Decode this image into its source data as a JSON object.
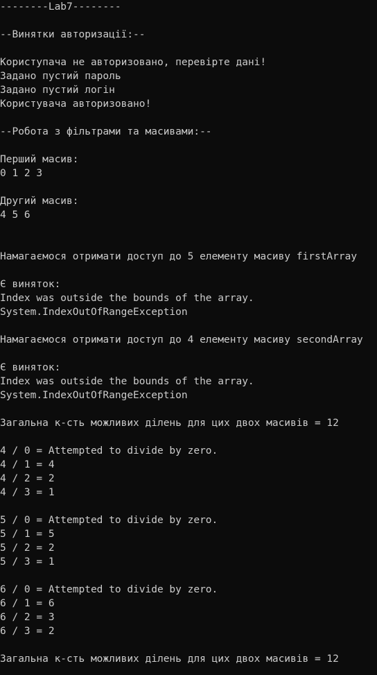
{
  "console": {
    "lines": [
      "--------Lab7--------",
      "",
      "--Винятки авторизації:--",
      "",
      "Користупача не авторизовано, перевірте дані!",
      "Задано пустий пароль",
      "Задано пустий логін",
      "Користувача авторизовано!",
      "",
      "--Робота з фільтрами та масивами:--",
      "",
      "Перший масив:",
      "0 1 2 3",
      "",
      "Другий масив:",
      "4 5 6",
      "",
      "",
      "Намагаємося отримати доступ до 5 елементу масиву firstArray",
      "",
      "Є виняток:",
      "Index was outside the bounds of the array.",
      "System.IndexOutOfRangeException",
      "",
      "Намагаємося отримати доступ до 4 елементу масиву secondArray",
      "",
      "Є виняток:",
      "Index was outside the bounds of the array.",
      "System.IndexOutOfRangeException",
      "",
      "Загальна к-сть можливих ділень для цих двох масивів = 12",
      "",
      "4 / 0 = Attempted to divide by zero.",
      "4 / 1 = 4",
      "4 / 2 = 2",
      "4 / 3 = 1",
      "",
      "5 / 0 = Attempted to divide by zero.",
      "5 / 1 = 5",
      "5 / 2 = 2",
      "5 / 3 = 1",
      "",
      "6 / 0 = Attempted to divide by zero.",
      "6 / 1 = 6",
      "6 / 2 = 3",
      "6 / 3 = 2",
      "",
      "Загальна к-сть можливих ділень для цих двох масивів = 12"
    ]
  }
}
